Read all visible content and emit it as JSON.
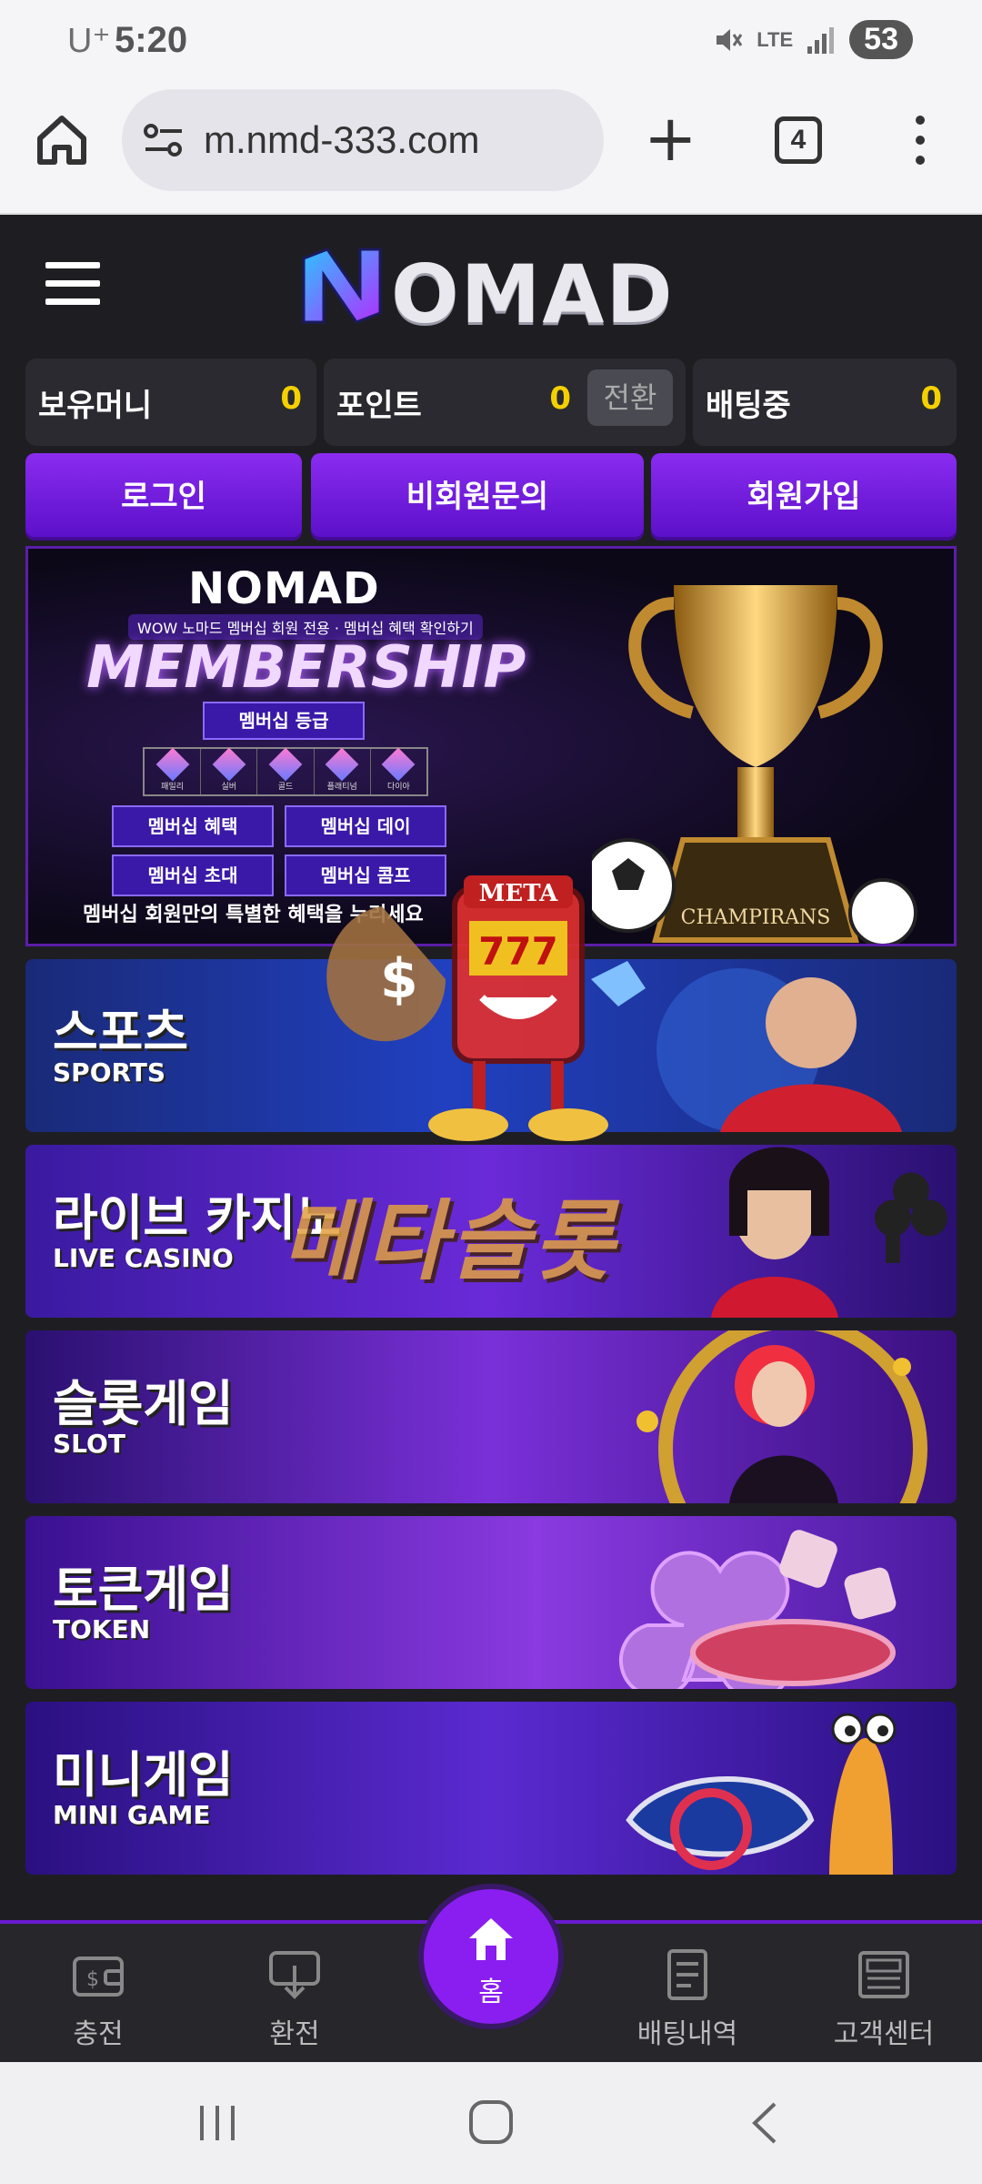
{
  "status": {
    "carrier": "U⁺",
    "time": "5:20",
    "network": "LTE",
    "battery": "53"
  },
  "browser": {
    "url": "m.nmd-333.com",
    "tab_count": "4"
  },
  "site": {
    "logo": "OMAD",
    "wallet": [
      {
        "label": "보유머니",
        "value": "0"
      },
      {
        "label": "포인트",
        "value": "0",
        "action": "전환"
      },
      {
        "label": "배팅중",
        "value": "0"
      }
    ],
    "auth": {
      "login": "로그인",
      "inquiry": "비회원문의",
      "signup": "회원가입"
    },
    "banner": {
      "logo": "NOMAD",
      "badge": "WOW 노마드 멤버십 회원 전용 · 멤버십 혜택 확인하기",
      "title": "MEMBERSHIP",
      "grade_button": "멤버십 등급",
      "grades": [
        "패밀리",
        "실버",
        "골드",
        "플래티넘",
        "다이아"
      ],
      "buttons": [
        "멤버십 혜택",
        "멤버십 데이",
        "멤버십 초대",
        "멤버십 콤프"
      ],
      "footer": "멤버십 회원만의 특별한 혜택을 누리세요",
      "trophy_label": "CHAMPIRANS"
    },
    "games": [
      {
        "kor": "스포츠",
        "eng": "SPORTS"
      },
      {
        "kor": "라이브 카지노",
        "eng": "LIVE CASINO"
      },
      {
        "kor": "슬롯게임",
        "eng": "SLOT"
      },
      {
        "kor": "토큰게임",
        "eng": "TOKEN"
      },
      {
        "kor": "미니게임",
        "eng": "MINI GAME"
      }
    ],
    "watermark": {
      "sign": "META",
      "reels": "777",
      "text": "메타슬롯"
    }
  },
  "bottom_nav": {
    "deposit": "충전",
    "withdraw": "환전",
    "home": "홈",
    "history": "배팅내역",
    "support": "고객센터"
  },
  "colors": {
    "accent": "#8a1ef0",
    "money": "#f5d000",
    "bg": "#1e1e22"
  }
}
